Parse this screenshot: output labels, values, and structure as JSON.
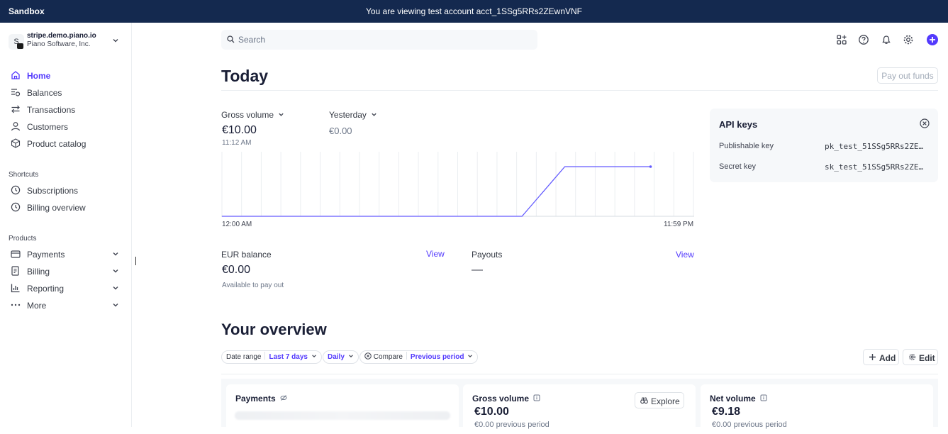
{
  "banner": {
    "sandbox_label": "Sandbox",
    "message": "You are viewing test account acct_1SSg5RRs2ZEwnVNF"
  },
  "account": {
    "avatar_letter": "S",
    "domain": "stripe.demo.piano.io",
    "company": "Piano Software, Inc."
  },
  "nav": {
    "main": [
      {
        "label": "Home",
        "icon": "home-icon",
        "active": true
      },
      {
        "label": "Balances",
        "icon": "balances-icon"
      },
      {
        "label": "Transactions",
        "icon": "transactions-icon"
      },
      {
        "label": "Customers",
        "icon": "customers-icon"
      },
      {
        "label": "Product catalog",
        "icon": "product-catalog-icon"
      }
    ],
    "shortcuts_title": "Shortcuts",
    "shortcuts": [
      {
        "label": "Subscriptions",
        "icon": "clock-icon"
      },
      {
        "label": "Billing overview",
        "icon": "clock-icon"
      }
    ],
    "products_title": "Products",
    "products": [
      {
        "label": "Payments",
        "icon": "payments-icon"
      },
      {
        "label": "Billing",
        "icon": "billing-icon"
      },
      {
        "label": "Reporting",
        "icon": "reporting-icon"
      },
      {
        "label": "More",
        "icon": "more-icon"
      }
    ]
  },
  "search": {
    "placeholder": "Search"
  },
  "today": {
    "title": "Today",
    "payout_button": "Pay out funds",
    "gross_volume_label": "Gross volume",
    "gross_volume_value": "€10.00",
    "gross_volume_time": "11:12 AM",
    "yesterday_label": "Yesterday",
    "yesterday_value": "€0.00",
    "axis_start": "12:00 AM",
    "axis_end": "11:59 PM",
    "eur_balance_label": "EUR balance",
    "eur_balance_value": "€0.00",
    "eur_balance_sub": "Available to pay out",
    "payouts_label": "Payouts",
    "payouts_value": "—",
    "view_label": "View"
  },
  "chart_data": {
    "type": "line",
    "x": [
      0,
      1,
      2,
      3,
      4,
      5,
      6,
      7,
      8,
      9,
      10,
      11
    ],
    "series": [
      {
        "values": [
          0,
          0,
          0,
          0,
          0,
          0,
          0,
          0,
          10,
          10,
          10,
          null
        ]
      }
    ],
    "ylim": [
      0,
      13
    ],
    "grid": true,
    "color": "#635bff"
  },
  "api_keys": {
    "title": "API keys",
    "publishable_label": "Publishable key",
    "publishable_value": "pk_test_51SSg5RRs2ZE…",
    "secret_label": "Secret key",
    "secret_value": "sk_test_51SSg5RRs2ZE…"
  },
  "overview": {
    "title": "Your overview",
    "date_range_label": "Date range",
    "date_range_value": "Last 7 days",
    "interval_value": "Daily",
    "compare_label": "Compare",
    "compare_value": "Previous period",
    "add_label": "Add",
    "edit_label": "Edit",
    "cards": [
      {
        "title": "Payments"
      },
      {
        "title": "Gross volume",
        "value": "€10.00",
        "sub": "€0.00 previous period",
        "explore": "Explore"
      },
      {
        "title": "Net volume",
        "value": "€9.18",
        "sub": "€0.00 previous period"
      }
    ]
  },
  "colors": {
    "accent": "#533afd",
    "banner": "#14294f"
  }
}
